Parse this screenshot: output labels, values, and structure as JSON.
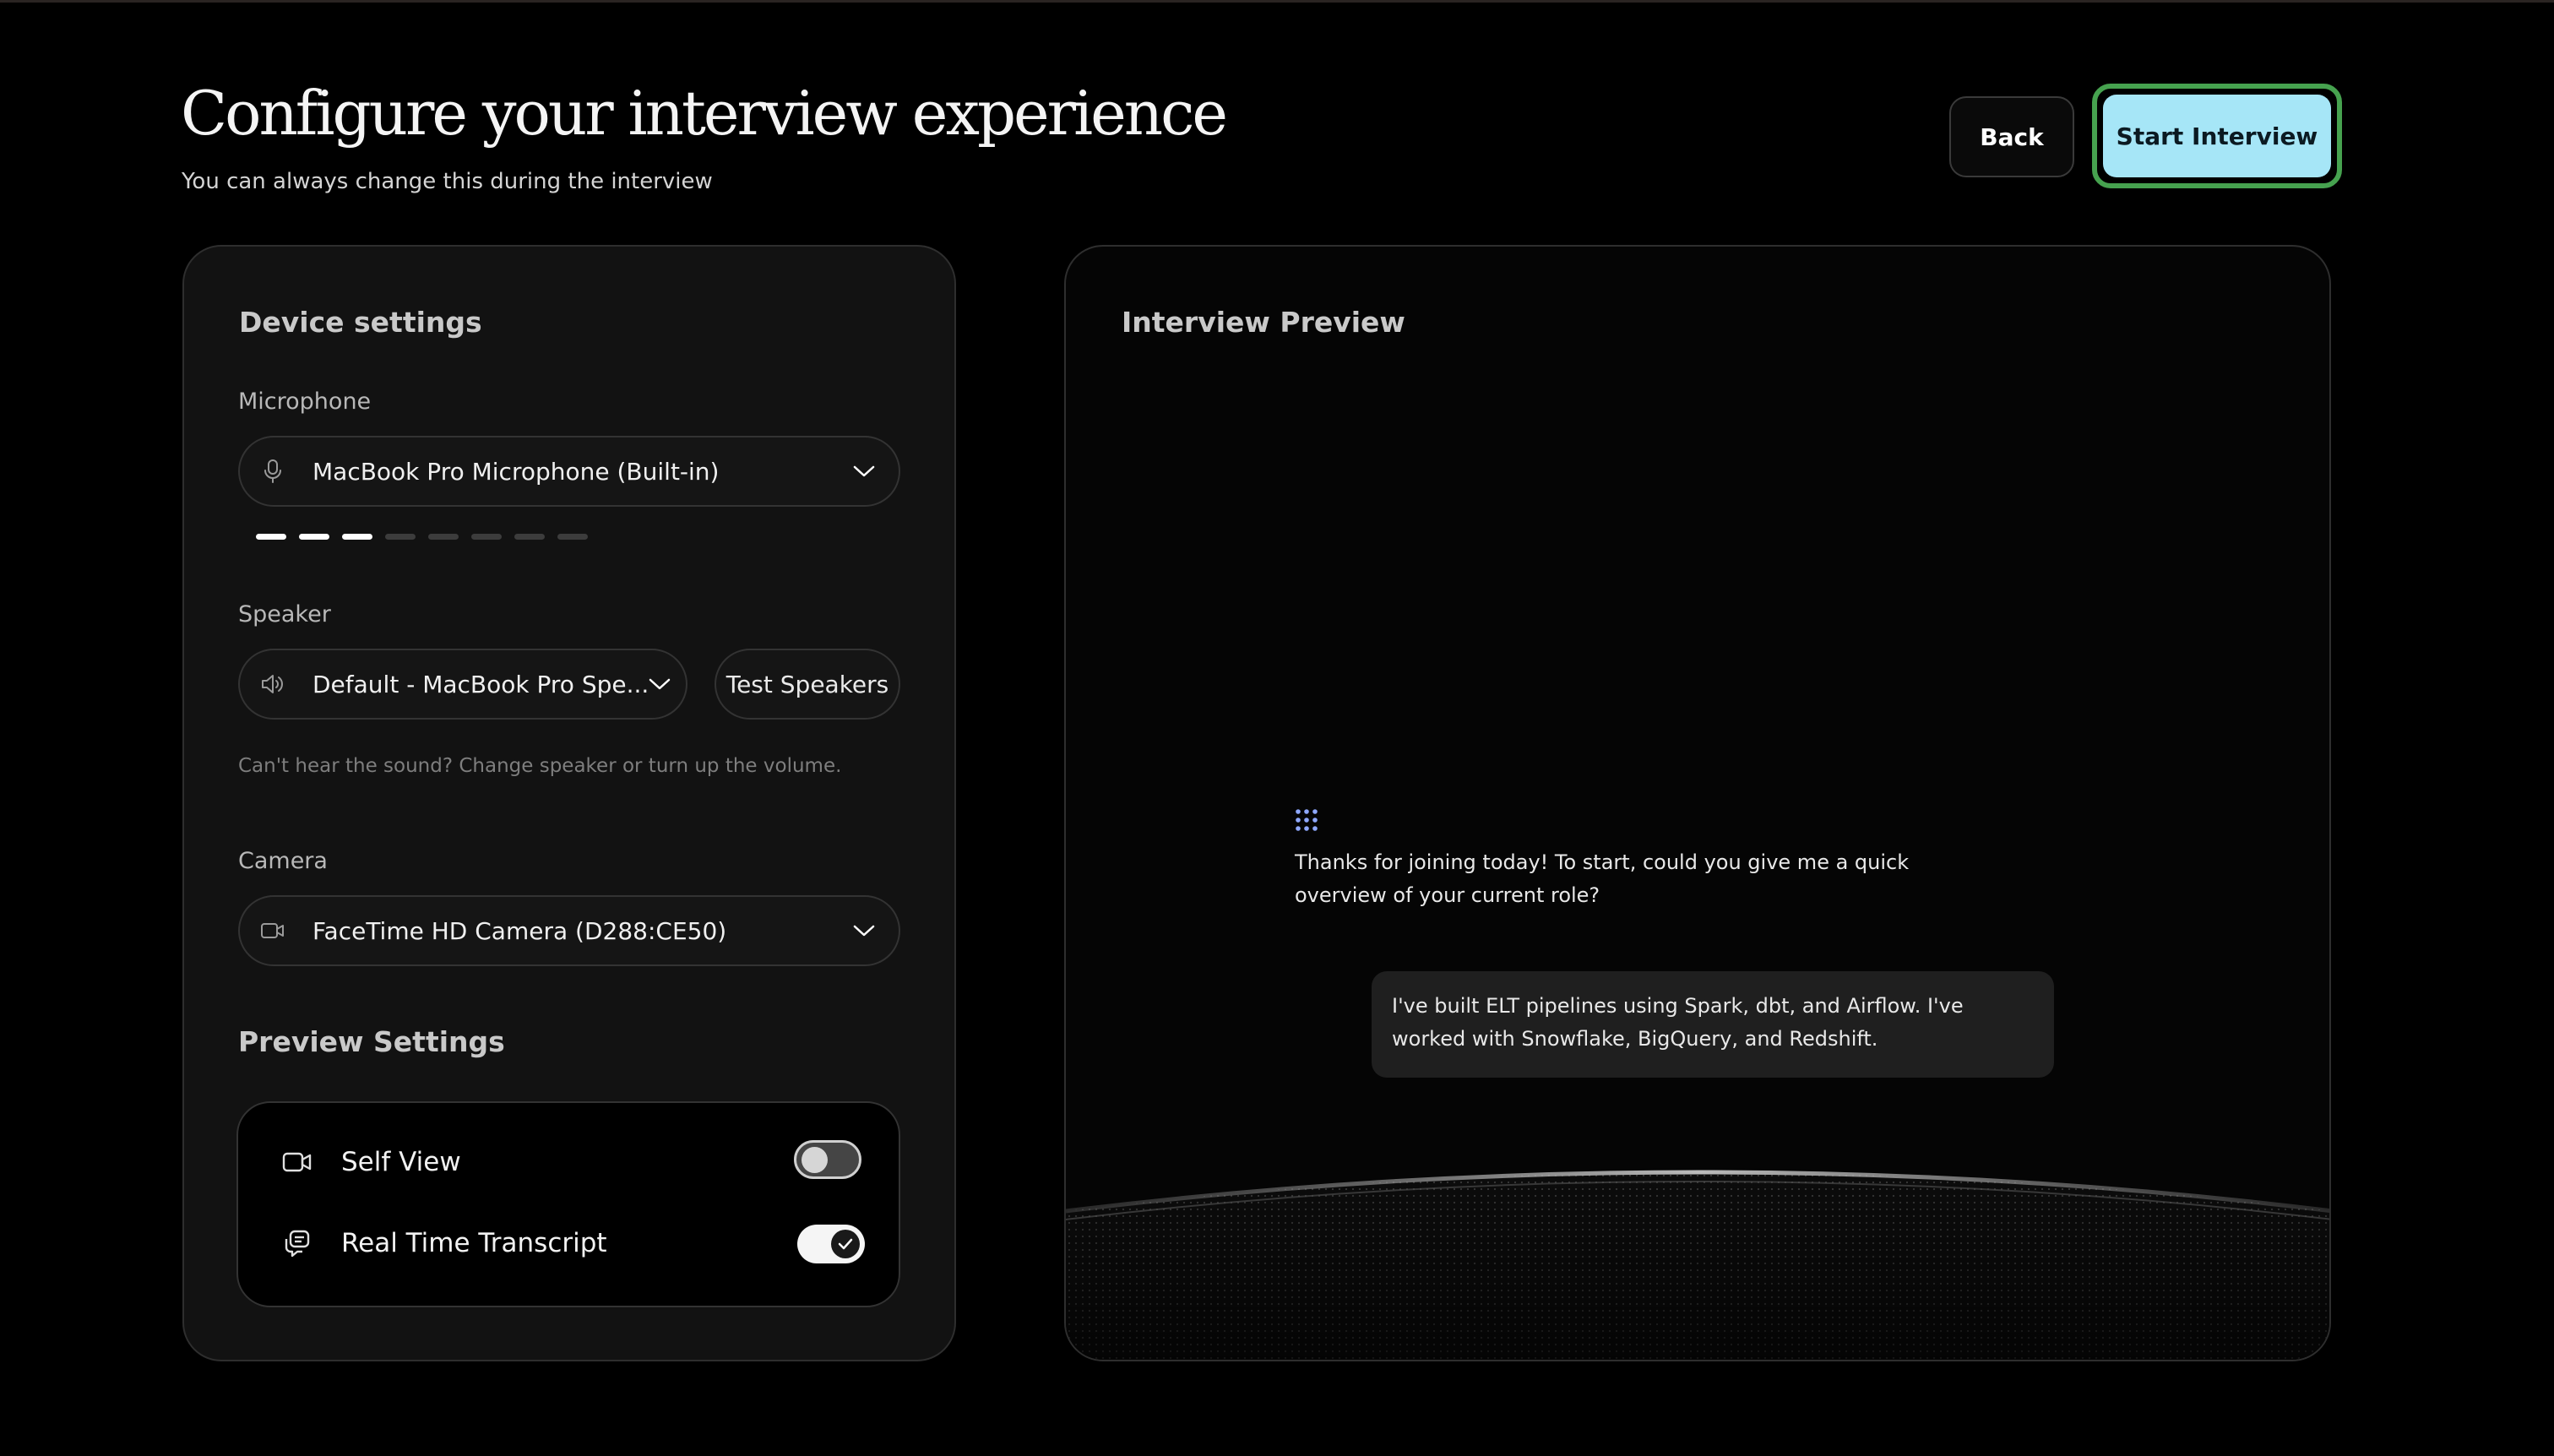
{
  "header": {
    "title": "Configure your interview experience",
    "subtitle": "You can always change this during the interview",
    "back_label": "Back",
    "start_label": "Start Interview"
  },
  "device_settings": {
    "title": "Device settings",
    "microphone": {
      "label": "Microphone",
      "value": "MacBook Pro Microphone (Built-in)",
      "icon": "microphone-icon",
      "level_active": 3,
      "level_total": 8
    },
    "speaker": {
      "label": "Speaker",
      "value": "Default - MacBook Pro Spe...",
      "icon": "speaker-icon",
      "test_label": "Test Speakers",
      "hint": "Can't hear the sound? Change speaker or turn up the volume."
    },
    "camera": {
      "label": "Camera",
      "value": "FaceTime HD Camera (D288:CE50)",
      "icon": "video-camera-icon"
    }
  },
  "preview_settings": {
    "title": "Preview Settings",
    "items": [
      {
        "label": "Self View",
        "icon": "video-camera-icon",
        "enabled": false
      },
      {
        "label": "Real Time Transcript",
        "icon": "transcript-icon",
        "enabled": true
      }
    ]
  },
  "preview": {
    "title": "Interview Preview",
    "ai_message": "Thanks for joining today! To start, could you give me a quick overview of your current role?",
    "user_message": "I've built ELT pipelines using Spark, dbt, and Airflow. I've worked with Snowflake, BigQuery, and Redshift.",
    "ai_icon": "dot-grid-icon"
  },
  "colors": {
    "background": "#000000",
    "card": "#121212",
    "accent": "#a6e6f7",
    "focus_ring": "#46a24f",
    "ai_dots": "#8fa8ff"
  }
}
